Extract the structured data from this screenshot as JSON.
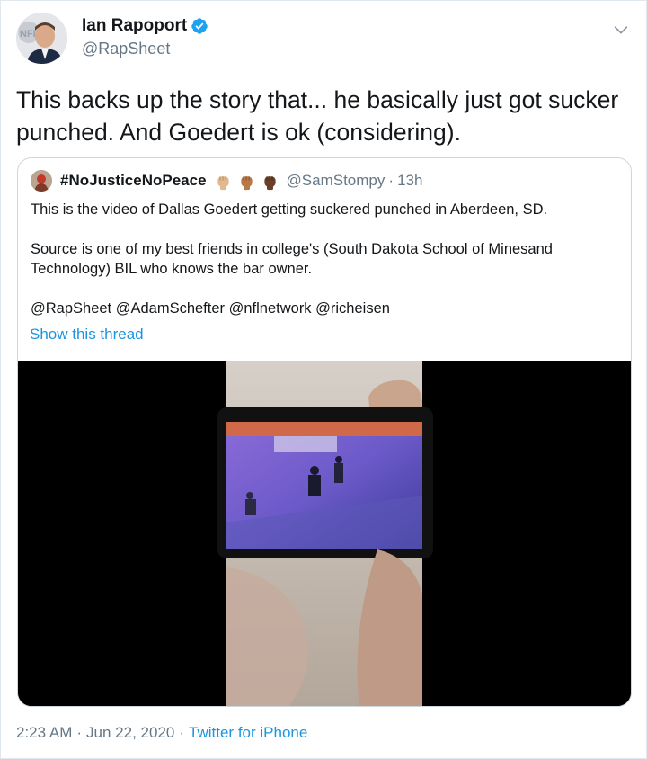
{
  "tweet": {
    "author_name": "Ian Rapoport",
    "author_handle": "@RapSheet",
    "verified": true,
    "text": "This backs up the story that... he basically just got sucker punched. And Goedert is ok (considering).",
    "timestamp_time": "2:23 AM",
    "timestamp_date": "Jun 22, 2020",
    "source": "Twitter for iPhone",
    "separator": "·"
  },
  "quoted": {
    "author_name": "#NoJusticeNoPeace",
    "author_handle": "@SamStompy",
    "separator": "·",
    "time": "13h",
    "fist_emojis": [
      "#e2b88f",
      "#b97945",
      "#6b4028"
    ],
    "lines": [
      "This is the video of Dallas Goedert getting suckered punched in Aberdeen, SD.",
      "Source is one of my best friends in college's (South Dakota School of Minesand",
      "Technology) BIL who knows the bar owner.",
      "@RapSheet @AdamSchefter @nflnetwork @richeisen"
    ],
    "show_thread": "Show this thread",
    "media": {
      "type": "video",
      "description_icon": "video-thumbnail"
    }
  },
  "colors": {
    "link": "#1b95e0",
    "secondary_text": "#657786",
    "primary_text": "#14171a",
    "border": "#ccd6dd",
    "verified": "#1da1f2"
  }
}
